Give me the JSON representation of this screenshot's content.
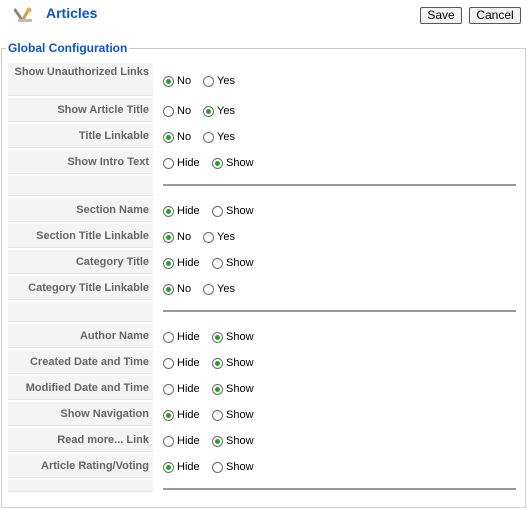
{
  "header": {
    "title": "Articles",
    "save_label": "Save",
    "cancel_label": "Cancel"
  },
  "legend": "Global Configuration",
  "rows": [
    {
      "label": "Show Unauthorized Links",
      "opt1": "No",
      "opt2": "Yes",
      "selected": 1
    },
    {
      "label": "Show Article Title",
      "opt1": "No",
      "opt2": "Yes",
      "selected": 2
    },
    {
      "label": "Title Linkable",
      "opt1": "No",
      "opt2": "Yes",
      "selected": 1
    },
    {
      "label": "Show Intro Text",
      "opt1": "Hide",
      "opt2": "Show",
      "selected": 2
    },
    {
      "label": "Section Name",
      "opt1": "Hide",
      "opt2": "Show",
      "selected": 1
    },
    {
      "label": "Section Title Linkable",
      "opt1": "No",
      "opt2": "Yes",
      "selected": 1
    },
    {
      "label": "Category Title",
      "opt1": "Hide",
      "opt2": "Show",
      "selected": 1
    },
    {
      "label": "Category Title Linkable",
      "opt1": "No",
      "opt2": "Yes",
      "selected": 1
    },
    {
      "label": "Author Name",
      "opt1": "Hide",
      "opt2": "Show",
      "selected": 2
    },
    {
      "label": "Created Date and Time",
      "opt1": "Hide",
      "opt2": "Show",
      "selected": 2
    },
    {
      "label": "Modified Date and Time",
      "opt1": "Hide",
      "opt2": "Show",
      "selected": 2
    },
    {
      "label": "Show Navigation",
      "opt1": "Hide",
      "opt2": "Show",
      "selected": 1
    },
    {
      "label": "Read more... Link",
      "opt1": "Hide",
      "opt2": "Show",
      "selected": 2
    },
    {
      "label": "Article Rating/Voting",
      "opt1": "Hide",
      "opt2": "Show",
      "selected": 1
    }
  ]
}
